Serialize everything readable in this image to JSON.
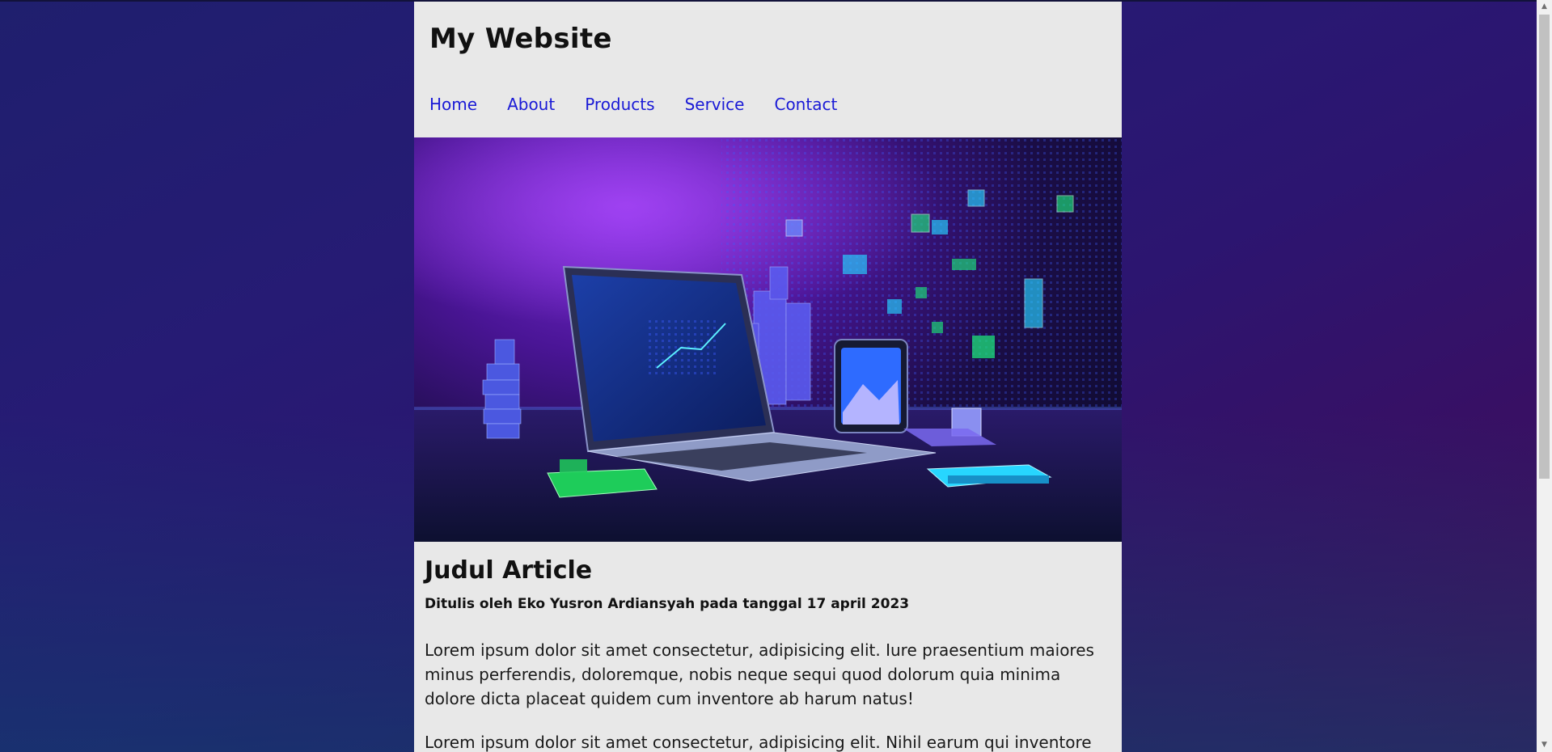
{
  "site": {
    "title": "My Website"
  },
  "nav": {
    "items": [
      {
        "label": "Home"
      },
      {
        "label": "About"
      },
      {
        "label": "Products"
      },
      {
        "label": "Service"
      },
      {
        "label": "Contact"
      }
    ]
  },
  "hero": {
    "icon": "laptop-tablet-illustration"
  },
  "article": {
    "title": "Judul Article",
    "meta": "Ditulis oleh Eko Yusron Ardiansyah pada tanggal 17 april 2023",
    "paragraphs": [
      "Lorem ipsum dolor sit amet consectetur, adipisicing elit. Iure praesentium maiores minus perferendis, doloremque, nobis neque sequi quod dolorum quia minima dolore dicta placeat quidem cum inventore ab harum natus!",
      "Lorem ipsum dolor sit amet consectetur, adipisicing elit. Nihil earum qui inventore"
    ]
  },
  "colors": {
    "nav_link": "#1a1ad6",
    "page_bg": "#e8e8e8"
  }
}
